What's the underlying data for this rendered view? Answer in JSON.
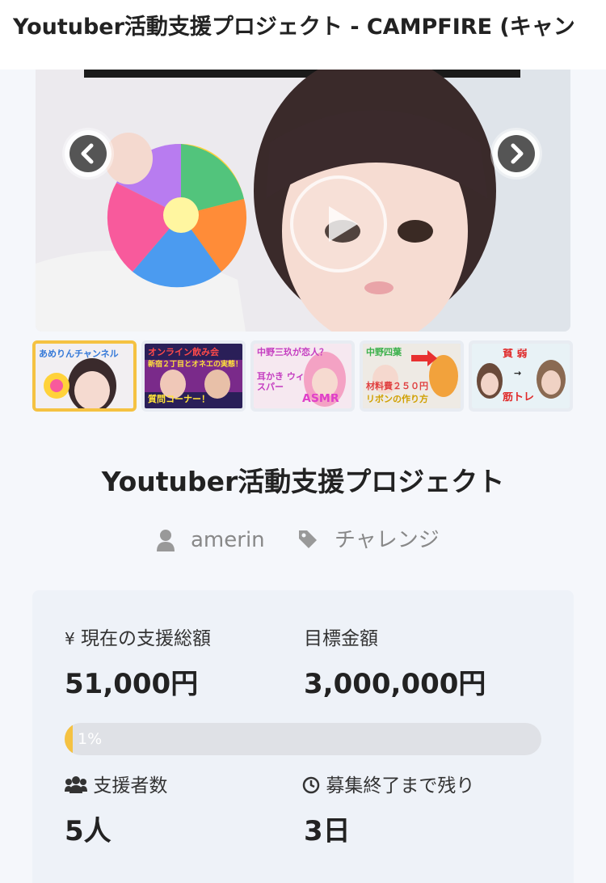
{
  "page": {
    "title": "Youtuber活動支援プロジェクト - CAMPFIRE (キャン"
  },
  "gallery": {
    "thumbnails": [
      {
        "caption_top": "あめりんチャンネル",
        "caption_bottom": ""
      },
      {
        "caption_top": "オンライン飲み会",
        "caption_mid": "新宿２丁目とオネエの実態！？",
        "caption_bottom": "質問コーナー！"
      },
      {
        "caption_top": "中野三玖が恋人？",
        "caption_mid": "耳かき ウィスパー",
        "caption_bottom": "ASMR"
      },
      {
        "caption_top": "中野四葉",
        "caption_mid": "材料費２５０円",
        "caption_bottom": "リボンの作り方"
      },
      {
        "caption_top": "貧 弱",
        "caption_mid": "→",
        "caption_bottom": "筋トレ"
      }
    ]
  },
  "project": {
    "title": "Youtuber活動支援プロジェクト",
    "author": "amerin",
    "category": "チャレンジ"
  },
  "stats": {
    "current_label": "現在の支援総額",
    "current_icon": "¥",
    "current_value": "51,000円",
    "goal_label": "目標金額",
    "goal_value": "3,000,000円",
    "progress_text": "1%",
    "progress_fraction": 0.017,
    "backers_label": "支援者数",
    "backers_value": "5人",
    "remaining_label": "募集終了まで残り",
    "remaining_value": "3日"
  },
  "colors": {
    "accent": "#f5c242",
    "panel": "#eef2f8"
  }
}
